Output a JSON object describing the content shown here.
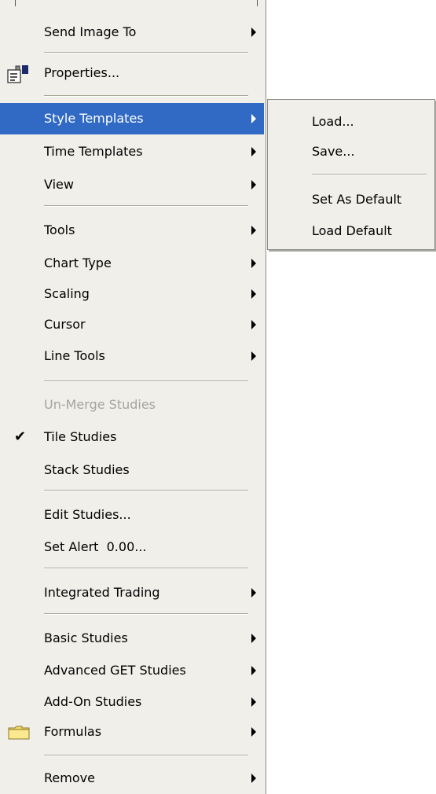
{
  "menu": {
    "items": [
      {
        "label": "Send Image To",
        "has_submenu": true
      },
      {
        "label": "Properties...",
        "icon": "properties-icon"
      },
      {
        "label": "Style Templates",
        "has_submenu": true,
        "selected": true
      },
      {
        "label": "Time Templates",
        "has_submenu": true
      },
      {
        "label": "View",
        "has_submenu": true
      },
      {
        "label": "Tools",
        "has_submenu": true
      },
      {
        "label": "Chart Type",
        "has_submenu": true
      },
      {
        "label": "Scaling",
        "has_submenu": true
      },
      {
        "label": "Cursor",
        "has_submenu": true
      },
      {
        "label": "Line Tools",
        "has_submenu": true
      },
      {
        "label": "Un-Merge Studies",
        "disabled": true
      },
      {
        "label": "Tile Studies",
        "checked": true
      },
      {
        "label": "Stack Studies"
      },
      {
        "label": "Edit Studies..."
      },
      {
        "label": "Set Alert  0.00..."
      },
      {
        "label": "Integrated Trading",
        "has_submenu": true
      },
      {
        "label": "Basic Studies",
        "has_submenu": true
      },
      {
        "label": "Advanced GET Studies",
        "has_submenu": true
      },
      {
        "label": "Add-On Studies",
        "has_submenu": true
      },
      {
        "label": "Formulas",
        "has_submenu": true,
        "icon": "folder-icon"
      },
      {
        "label": "Remove",
        "has_submenu": true
      }
    ]
  },
  "submenu": {
    "items": [
      {
        "label": "Load..."
      },
      {
        "label": "Save..."
      },
      {
        "label": "Set As Default"
      },
      {
        "label": "Load Default"
      }
    ]
  },
  "colors": {
    "menu_background": "#f0efea",
    "selection": "#316ac5",
    "disabled_text": "#a5a49f",
    "folder": "#f5d867"
  }
}
